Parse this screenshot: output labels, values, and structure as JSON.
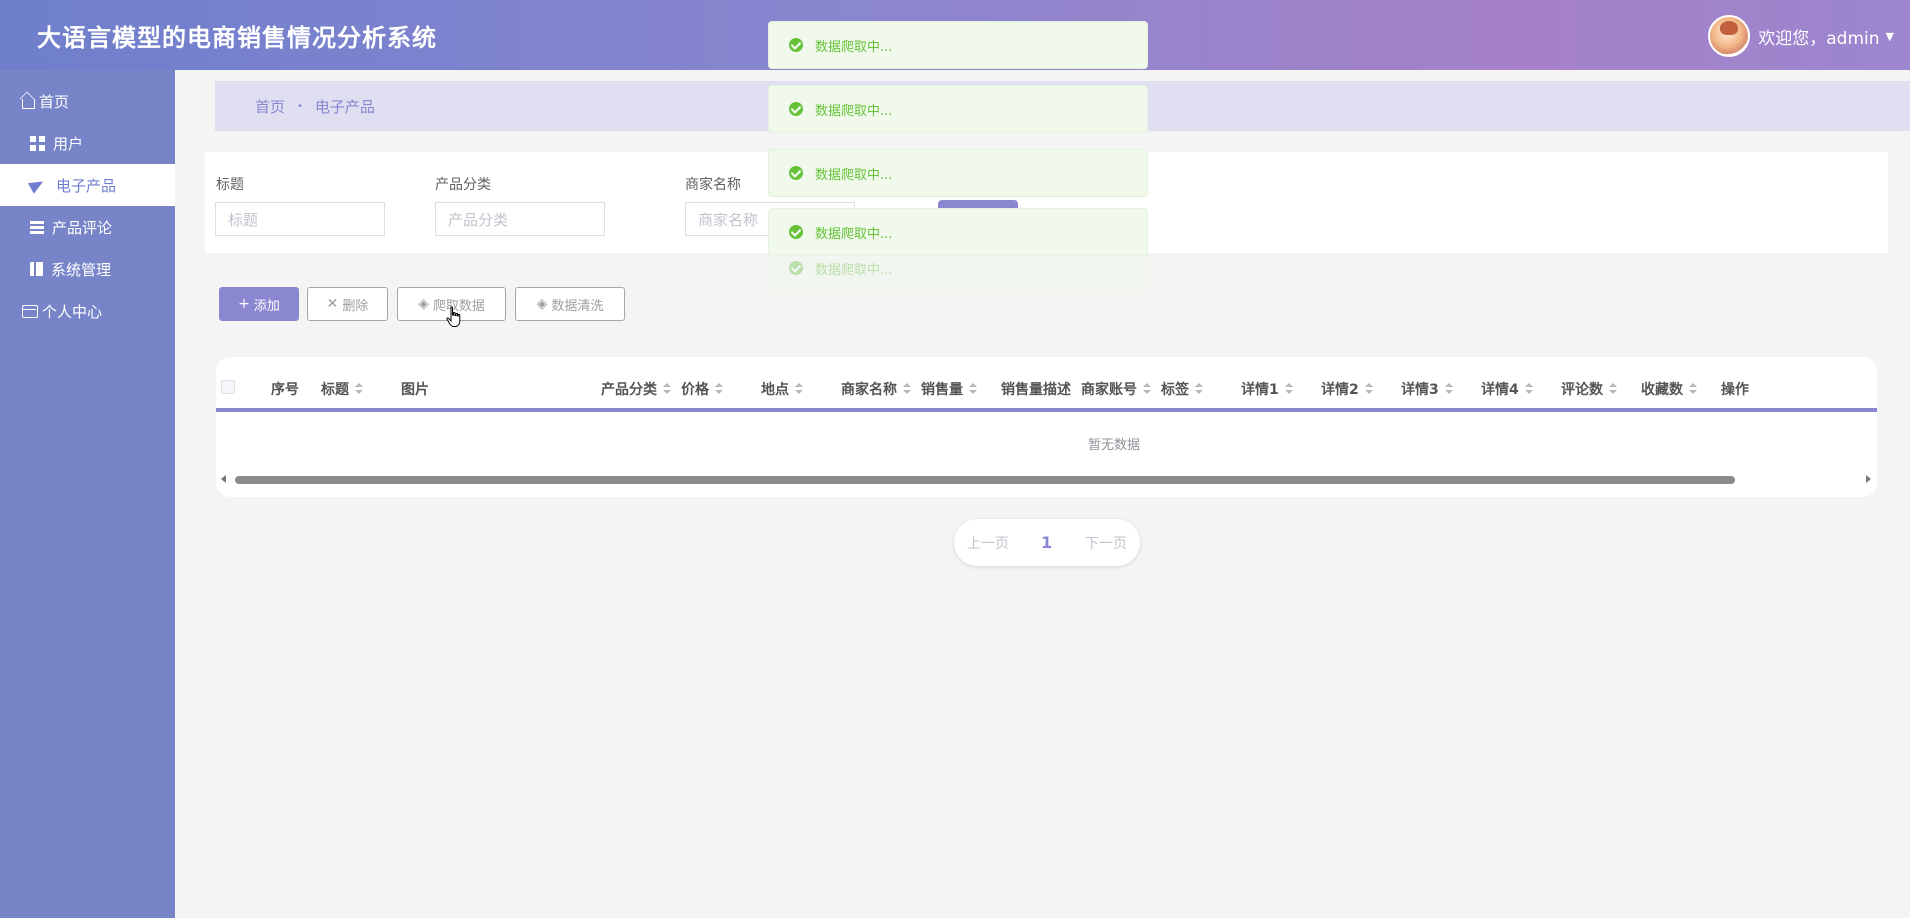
{
  "header": {
    "title": "大语言模型的电商销售情况分析系统",
    "welcome": "欢迎您，admin"
  },
  "sidebar": {
    "items": [
      {
        "label": "首页",
        "icon": "home-icon"
      },
      {
        "label": "用户",
        "icon": "grid-icon"
      },
      {
        "label": "电子产品",
        "icon": "paper-plane-icon",
        "active": true
      },
      {
        "label": "产品评论",
        "icon": "list-icon"
      },
      {
        "label": "系统管理",
        "icon": "book-icon"
      },
      {
        "label": "个人中心",
        "icon": "card-icon"
      }
    ]
  },
  "breadcrumb": {
    "home": "首页",
    "separator": "•",
    "current": "电子产品"
  },
  "search": {
    "title_label": "标题",
    "title_placeholder": "标题",
    "category_label": "产品分类",
    "category_placeholder": "产品分类",
    "merchant_label": "商家名称",
    "merchant_placeholder": "商家名称"
  },
  "actions": {
    "add": "添加",
    "delete": "删除",
    "crawl": "爬取数据",
    "clean": "数据清洗"
  },
  "table": {
    "columns": [
      "序号",
      "标题",
      "图片",
      "产品分类",
      "价格",
      "地点",
      "商家名称",
      "销售量",
      "销售量描述",
      "商家账号",
      "标签",
      "详情1",
      "详情2",
      "详情3",
      "详情4",
      "评论数",
      "收藏数",
      "操作"
    ],
    "empty_text": "暂无数据"
  },
  "pagination": {
    "prev": "上一页",
    "current": "1",
    "next": "下一页"
  },
  "toasts": [
    "数据爬取中...",
    "数据爬取中...",
    "数据爬取中...",
    "数据爬取中...",
    "数据爬取中..."
  ],
  "colors": {
    "accent": "#8a86cf",
    "sidebar": "#7785c8",
    "success": "#67c23a"
  }
}
